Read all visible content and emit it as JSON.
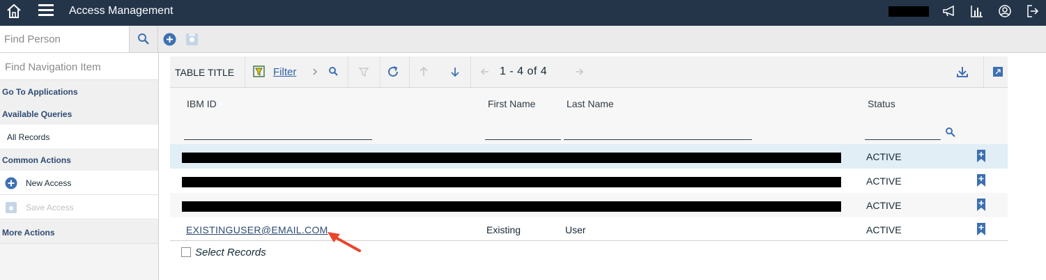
{
  "header": {
    "title": "Access Management"
  },
  "toolbar": {
    "find_person_placeholder": "Find Person"
  },
  "sidebar": {
    "find_nav_placeholder": "Find Navigation Item",
    "go_to_applications": "Go To Applications",
    "available_queries": "Available Queries",
    "all_records": "All Records",
    "common_actions": "Common Actions",
    "new_access": "New Access",
    "save_access": "Save Access",
    "more_actions": "More Actions"
  },
  "table": {
    "title": "TABLE TITLE",
    "filter_label": "Filter",
    "pager": "1 - 4 of 4",
    "columns": [
      "IBM ID",
      "First Name",
      "Last Name",
      "Status"
    ],
    "rows": [
      {
        "ibm_id": "",
        "first_name": "",
        "last_name": "",
        "status": "ACTIVE",
        "redacted": true
      },
      {
        "ibm_id": "",
        "first_name": "",
        "last_name": "",
        "status": "ACTIVE",
        "redacted": true
      },
      {
        "ibm_id": "",
        "first_name": "",
        "last_name": "",
        "status": "ACTIVE",
        "redacted": true
      },
      {
        "ibm_id": "EXISTINGUSER@EMAIL.COM",
        "first_name": "Existing",
        "last_name": "User",
        "status": "ACTIVE",
        "redacted": false
      }
    ],
    "select_records_label": "Select Records"
  },
  "colors": {
    "topbar_bg": "#24354a",
    "accent_blue": "#3d70b2",
    "row_highlight": "#e1eef5",
    "row_alt": "#f7f7f7",
    "annotation_red": "#e8452c"
  },
  "icons": [
    "home-icon",
    "hamburger-menu-icon",
    "megaphone-icon",
    "bar-chart-icon",
    "user-profile-icon",
    "logout-icon",
    "search-icon",
    "add-circle-icon",
    "save-icon",
    "filter-icon",
    "chevron-right-icon",
    "clear-filter-icon",
    "refresh-icon",
    "arrow-up-icon",
    "arrow-down-icon",
    "chevron-left-icon",
    "download-icon",
    "maximize-icon",
    "bookmark-add-icon",
    "red-arrow-annotation"
  ]
}
